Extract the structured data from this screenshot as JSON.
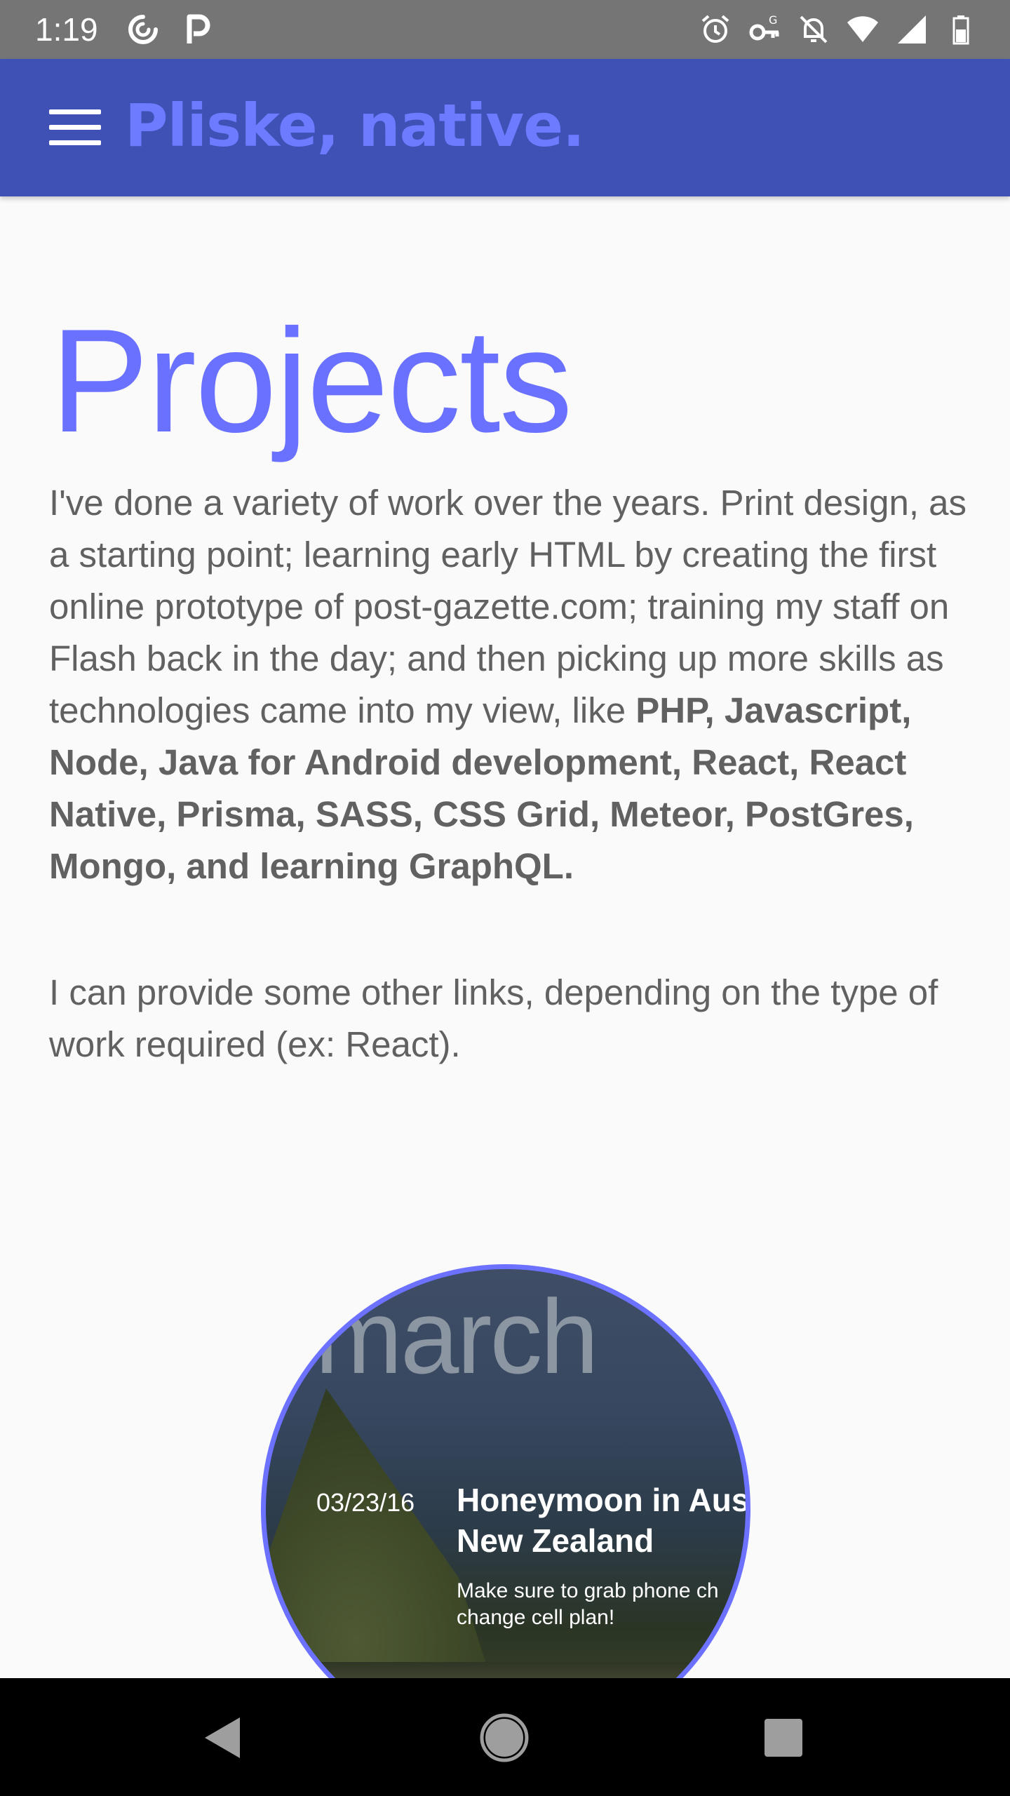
{
  "status_bar": {
    "time": "1:19",
    "left_icons": [
      "sync-icon",
      "parking-icon"
    ],
    "right_icons": [
      "alarm-icon",
      "vpn-key-icon",
      "notifications-off-icon",
      "wifi-icon",
      "signal-icon",
      "battery-icon"
    ]
  },
  "app_bar": {
    "title": "Pliske, native.",
    "menu_icon": "menu-icon",
    "background": "#3f51b5",
    "title_color": "#6c7bff"
  },
  "content": {
    "heading": "Projects",
    "heading_color": "#6a71ff",
    "para1_text": "I've done a variety of work over the years. Print design, as a starting point; learning early HTML by creating the first online prototype of post-gazette.com; training my staff on Flash back in the day; and then picking up more skills as technologies came into my view, like ",
    "para1_bold": "PHP, Javascript, Node, Java for Android development, React, React Native, Prisma, SASS, CSS Grid, Meteor, PostGres, Mongo, and learning GraphQL.",
    "para2": "I can provide some other links, depending on the type of work required (ex: React)."
  },
  "project_card": {
    "overlay_word": "march",
    "date": "03/23/16",
    "title": "Honeymoon in Aus\nNew Zealand",
    "description": "Make sure to grab phone ch\nchange cell plan!",
    "border_color": "#6c72ff"
  },
  "nav_bar": {
    "back_icon": "back-triangle-icon",
    "home_icon": "home-circle-icon",
    "recents_icon": "recents-square-icon"
  }
}
